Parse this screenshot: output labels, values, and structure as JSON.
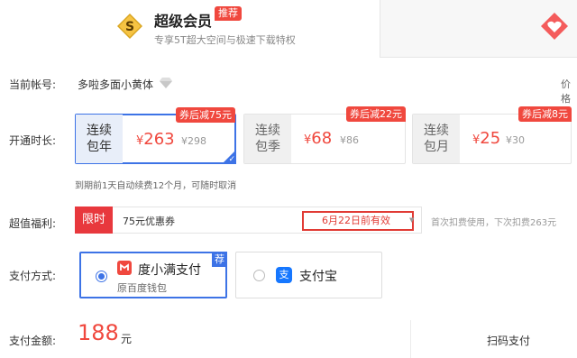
{
  "header": {
    "title": "超级会员",
    "badge": "推荐",
    "subtitle": "专享5T超大空间与极速下载特权",
    "vip_icon_letter": "S"
  },
  "account": {
    "label": "当前帐号:",
    "name": "多啦多面小黄体",
    "right_link": "价格"
  },
  "duration": {
    "label": "开通时长:",
    "plans": [
      {
        "name_line1": "连续",
        "name_line2": "包年",
        "currency": "¥",
        "price": "263",
        "original": "¥298",
        "tag": "券后减75元",
        "selected": true
      },
      {
        "name_line1": "连续",
        "name_line2": "包季",
        "currency": "¥",
        "price": "68",
        "original": "¥86",
        "tag": "券后减22元",
        "selected": false
      },
      {
        "name_line1": "连续",
        "name_line2": "包月",
        "currency": "¥",
        "price": "25",
        "original": "¥30",
        "tag": "券后减8元",
        "selected": false
      }
    ],
    "renew_note": "到期前1天自动续费12个月，可随时取消"
  },
  "benefit": {
    "label": "超值福利:",
    "limit_tag": "限时",
    "coupon": "75元优惠券",
    "expiry": "6月22日前有效",
    "note": "首次扣费使用，下次扣费263元"
  },
  "payment": {
    "label": "支付方式:",
    "methods": [
      {
        "name": "度小满支付",
        "sub": "原百度钱包",
        "tag": "荐",
        "selected": true
      },
      {
        "name": "支付宝",
        "icon_char": "支",
        "selected": false
      }
    ]
  },
  "amount": {
    "label": "支付金额:",
    "value": "188",
    "unit": "元"
  },
  "scan": {
    "label": "扫码支付"
  },
  "colors": {
    "accent_red": "#f0483e",
    "accent_blue": "#3d73e6",
    "gold": "#f2b233"
  }
}
